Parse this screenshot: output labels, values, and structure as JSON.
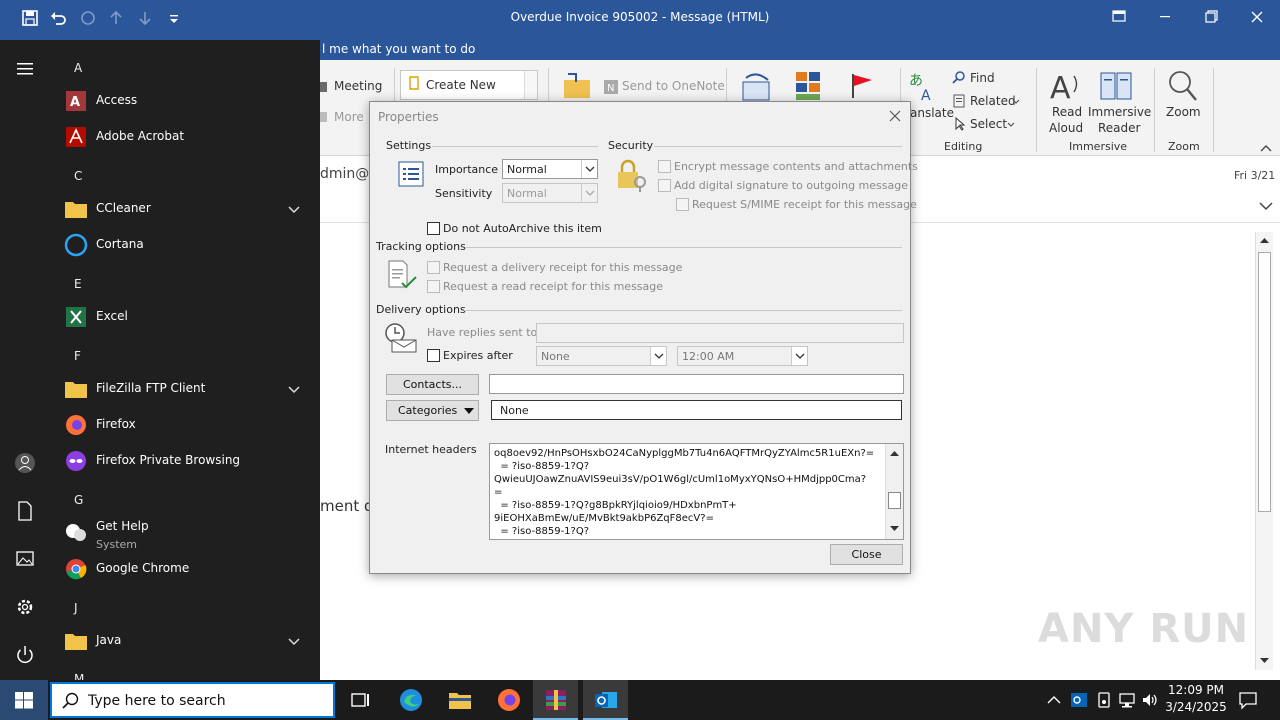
{
  "window": {
    "title": "Overdue Invoice 905002  -  Message (HTML)"
  },
  "tellme": {
    "text": "l me what you want to do"
  },
  "ribbon": {
    "meeting": "Meeting",
    "more": "More",
    "create_new": "Create New",
    "send_to_onenote": "Send to OneNote",
    "translate": "anslate",
    "find": "Find",
    "related": "Related",
    "select": "Select",
    "editing_label": "Editing",
    "read_aloud_1": "Read",
    "read_aloud_2": "Aloud",
    "immersive_1": "Immersive",
    "immersive_2": "Reader",
    "immersive_label": "Immersive",
    "zoom": "Zoom",
    "zoom_label": "Zoom"
  },
  "message": {
    "from_partial": "dmin@c",
    "date": "Fri 3/21",
    "body_partial": "ment dat"
  },
  "start_menu": {
    "letters": [
      "A",
      "C",
      "E",
      "F",
      "G",
      "J",
      "M"
    ],
    "apps": [
      {
        "label": "Access",
        "icon": "access-icon"
      },
      {
        "label": "Adobe Acrobat",
        "icon": "acrobat-icon"
      },
      {
        "label": "CCleaner",
        "icon": "folder-icon"
      },
      {
        "label": "Cortana",
        "icon": "cortana-icon"
      },
      {
        "label": "Excel",
        "icon": "excel-icon"
      },
      {
        "label": "FileZilla FTP Client",
        "icon": "folder-icon"
      },
      {
        "label": "Firefox",
        "icon": "firefox-icon"
      },
      {
        "label": "Firefox Private Browsing",
        "icon": "firefox-private-icon"
      },
      {
        "label": "Get Help",
        "sub": "System",
        "icon": "help-icon"
      },
      {
        "label": "Google Chrome",
        "icon": "chrome-icon"
      },
      {
        "label": "Java",
        "icon": "folder-icon"
      }
    ]
  },
  "dialog": {
    "title": "Properties",
    "settings_label": "Settings",
    "importance_label": "Importance",
    "importance_value": "Normal",
    "sensitivity_label": "Sensitivity",
    "sensitivity_value": "Normal",
    "autoarchive": "Do not AutoArchive this item",
    "security_label": "Security",
    "encrypt": "Encrypt message contents and attachments",
    "signature": "Add digital signature to outgoing message",
    "smime": "Request S/MIME receipt for this message",
    "tracking_label": "Tracking options",
    "delivery_receipt": "Request a delivery receipt for this message",
    "read_receipt": "Request a read receipt for this message",
    "delivery_label": "Delivery options",
    "replies_to": "Have replies sent to",
    "expires_after": "Expires after",
    "expires_date": "None",
    "expires_time": "12:00 AM",
    "contacts_button": "Contacts...",
    "categories_button": "Categories",
    "categories_value": "None",
    "headers_label": "Internet headers",
    "headers_text": "oq8oev92/HnPsOHsxbO24CaNyplggMb7Tu4n6AQFTMrQyZYAlmc5R1uEXn?=\n  = ?iso-8859-1?Q?\nQwieuUJOawZnuAVIS9eui3sV/pO1W6gl/cUml1oMyxYQNsO+HMdjpp0Cma?\n=\n  = ?iso-8859-1?Q?g8BpkRYjlqioio9/HDxbnPmT+\n9iEOHXaBmEw/uE/MvBkt9akbP6ZqF8ecV?=\n  = ?iso-8859-1?Q?",
    "close_button": "Close"
  },
  "taskbar": {
    "search_placeholder": "Type here to search",
    "time": "12:09 PM",
    "date": "3/24/2025"
  },
  "watermark": "ANY RUN"
}
